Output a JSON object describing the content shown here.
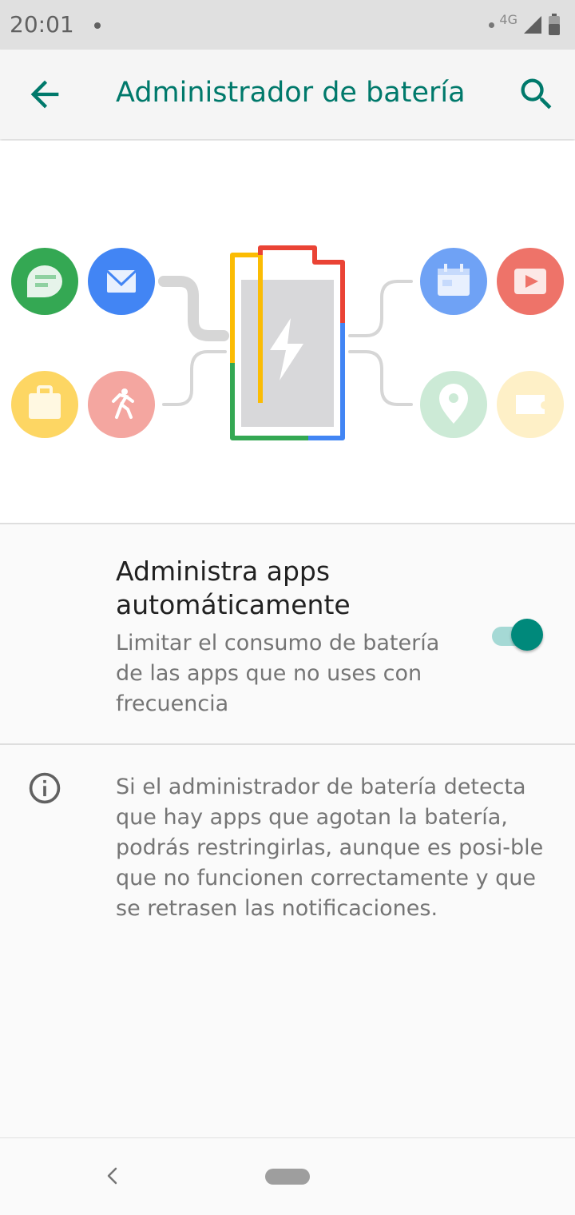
{
  "status_bar": {
    "time": "20:01",
    "network": "4G"
  },
  "app_bar": {
    "title": "Administrador de batería",
    "back_icon": "arrow-back-icon",
    "search_icon": "search-icon"
  },
  "colors": {
    "accent": "#00796b",
    "toggle_on": "#00897b",
    "google_red": "#ea4335",
    "google_yellow": "#fbbc04",
    "google_green": "#34a853",
    "google_blue": "#4285f4"
  },
  "illustration": {
    "icons": [
      "message-icon",
      "mail-icon",
      "briefcase-icon",
      "runner-icon",
      "calendar-icon",
      "video-icon",
      "location-icon",
      "ticket-icon",
      "battery-bolt-icon"
    ]
  },
  "setting": {
    "title": "Administra apps automáticamente",
    "subtitle": "Limitar el consumo de batería de las apps que no uses con frecuencia",
    "enabled": true
  },
  "info": {
    "text": "Si el administrador de batería detecta que hay apps que agotan la batería, podrás restringirlas, aunque es posi-ble que no funcionen correctamente y que se retrasen las notificaciones."
  },
  "nav_bar": {
    "back_icon": "nav-back-icon",
    "home_icon": "home-pill-icon"
  }
}
